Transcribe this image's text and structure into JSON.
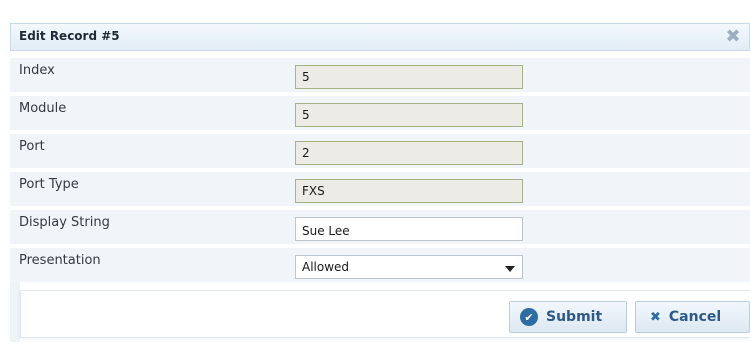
{
  "dialog": {
    "title": "Edit Record #5",
    "close_icon": "✖"
  },
  "fields": [
    {
      "label": "Index",
      "value": "5",
      "kind": "readonly"
    },
    {
      "label": "Module",
      "value": "5",
      "kind": "readonly"
    },
    {
      "label": "Port",
      "value": "2",
      "kind": "readonly"
    },
    {
      "label": "Port Type",
      "value": "FXS",
      "kind": "readonly"
    },
    {
      "label": "Display String",
      "value": "Sue Lee",
      "kind": "text"
    },
    {
      "label": "Presentation",
      "value": "Allowed",
      "kind": "select"
    }
  ],
  "actions": {
    "submit_label": "Submit",
    "cancel_label": "Cancel",
    "submit_icon": "check-circle-icon",
    "cancel_icon": "x-icon"
  },
  "colors": {
    "accent": "#2e6da4",
    "readonly_bg": "#ecebe5",
    "readonly_border": "#a6b38a"
  }
}
